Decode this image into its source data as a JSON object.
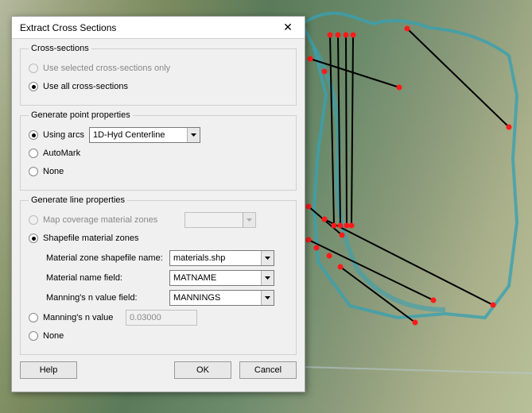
{
  "dialog": {
    "title": "Extract Cross Sections",
    "close_glyph": "✕"
  },
  "cross_sections": {
    "legend": "Cross-sections",
    "use_selected": "Use selected cross-sections only",
    "use_all": "Use all cross-sections"
  },
  "gen_point": {
    "legend": "Generate point properties",
    "using_arcs": "Using arcs",
    "arcs_value": "1D-Hyd Centerline",
    "automark": "AutoMark",
    "none": "None"
  },
  "gen_line": {
    "legend": "Generate line properties",
    "map_cov": "Map coverage material zones",
    "shp_zones": "Shapefile material zones",
    "shp_name_label": "Material zone shapefile name:",
    "shp_name_value": "materials.shp",
    "mat_field_label": "Material name field:",
    "mat_field_value": "MATNAME",
    "mann_field_label": "Manning's n value field:",
    "mann_field_value": "MANNINGS",
    "mann_n": "Manning's n value",
    "mann_n_value": "0.03000",
    "none": "None"
  },
  "buttons": {
    "help": "Help",
    "ok": "OK",
    "cancel": "Cancel"
  }
}
